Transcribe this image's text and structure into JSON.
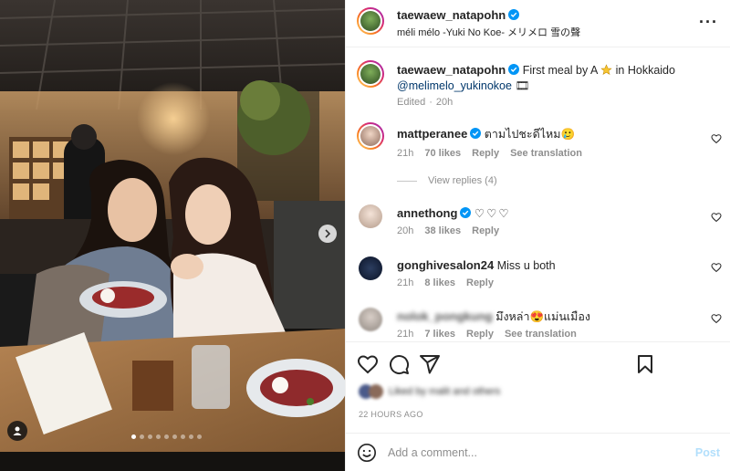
{
  "header": {
    "username": "taewaew_natapohn",
    "subtitle": "méli mélo -Yuki No Koe- メリメロ 雪の聲",
    "more_icon": "more-horizontal-icon"
  },
  "caption": {
    "username": "taewaew_natapohn",
    "text_before_star": "First meal by A",
    "text_after_star": "in Hokkaido",
    "mention": "@melimelo_yukinokoe",
    "emoji_box": "🎞",
    "edited": "Edited",
    "time": "20h"
  },
  "comments": [
    {
      "username": "mattperanee",
      "verified": true,
      "text": "ตามไปชะดีไหม",
      "text_tail": "🥲",
      "time": "21h",
      "likes": "70 likes",
      "reply": "Reply",
      "translate": "See translation",
      "view_replies": "View replies (4)"
    },
    {
      "username": "annethong",
      "verified": true,
      "text": "♡♡♡",
      "time": "20h",
      "likes": "38 likes",
      "reply": "Reply"
    },
    {
      "username": "gonghivesalon24",
      "verified": false,
      "text": "Miss u both",
      "time": "21h",
      "likes": "8 likes",
      "reply": "Reply"
    },
    {
      "username": "nolok_pongkung",
      "verified": false,
      "text_before": "มึงหล่า",
      "text_emoji": "😍",
      "text_after": "แม่นเมือง",
      "time": "21h",
      "likes": "7 likes",
      "reply": "Reply",
      "translate": "See translation"
    }
  ],
  "actions": {
    "liked_by": "Liked by malit and others",
    "timestamp": "22 HOURS AGO"
  },
  "add_comment": {
    "placeholder": "Add a comment...",
    "post": "Post"
  },
  "carousel": {
    "dots": 9,
    "active_index": 0
  },
  "colors": {
    "verified": "#0095f6",
    "link": "#00376b",
    "muted": "#8e8e8e",
    "post_disabled": "#b2dffc"
  }
}
